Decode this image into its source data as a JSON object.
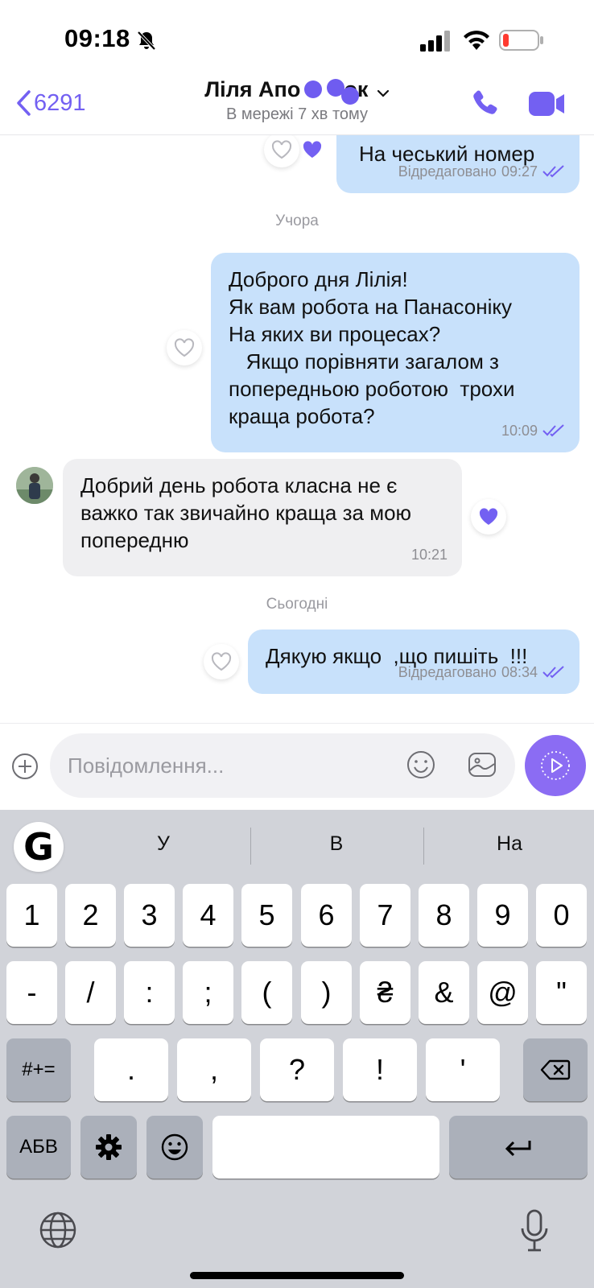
{
  "status_bar": {
    "time": "09:18"
  },
  "header": {
    "back_label": "6291",
    "contact_name": "Ліля Апо  ок",
    "status": "В мережі 7 хв тому"
  },
  "messages": [
    {
      "direction": "outgoing",
      "text": "На чеський номер",
      "edited_label": "Відредаговано",
      "time": "09:27"
    },
    {
      "type": "date",
      "label": "Учора"
    },
    {
      "direction": "outgoing",
      "text": "Доброго дня Лілія!\nЯк вам робота на Панасоніку\nНа яких ви процесах?\n   Якщо порівняти загалом з попередньою роботою  трохи краща робота?",
      "time": "10:09"
    },
    {
      "direction": "incoming",
      "text": "Добрий день робота класна не є важко так звичайно краща за мою попередню",
      "time": "10:21"
    },
    {
      "type": "date",
      "label": "Сьогодні"
    },
    {
      "direction": "outgoing",
      "text": "Дякую якщо  ,що пишіть  !!!",
      "edited_label": "Відредаговано",
      "time": "08:34"
    }
  ],
  "composer": {
    "placeholder": "Повідомлення..."
  },
  "keyboard": {
    "suggestions": [
      "У",
      "В",
      "На"
    ],
    "row1": [
      "1",
      "2",
      "3",
      "4",
      "5",
      "6",
      "7",
      "8",
      "9",
      "0"
    ],
    "row2": [
      "-",
      "/",
      ":",
      ";",
      "(",
      ")",
      "₴",
      "&",
      "@",
      "\""
    ],
    "row3": [
      ".",
      ",",
      "?",
      "!",
      "'"
    ],
    "shift_label": "#+=",
    "abc_label": "АБВ"
  },
  "colors": {
    "accent": "#7360f2",
    "outgoing_bubble": "#c8e1fb",
    "incoming_bubble": "#efeff1",
    "keyboard_bg": "#d1d3d9"
  }
}
